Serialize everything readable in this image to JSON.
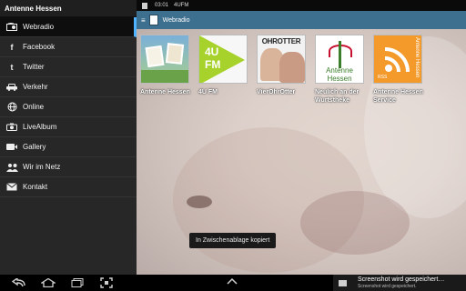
{
  "sidebar": {
    "title": "Antenne Hessen",
    "items": [
      {
        "label": "Webradio",
        "icon": "radio-icon",
        "active": true
      },
      {
        "label": "Facebook",
        "icon": "facebook-icon"
      },
      {
        "label": "Twitter",
        "icon": "twitter-icon"
      },
      {
        "label": "Verkehr",
        "icon": "car-icon"
      },
      {
        "label": "Online",
        "icon": "globe-icon"
      },
      {
        "label": "LiveAlbum",
        "icon": "camera-icon"
      },
      {
        "label": "Gallery",
        "icon": "video-camera-icon"
      },
      {
        "label": "Wir im Netz",
        "icon": "people-icon"
      },
      {
        "label": "Kontakt",
        "icon": "mail-icon"
      }
    ]
  },
  "statusbar": {
    "time": "03:01",
    "station": "4UFM"
  },
  "actionbar": {
    "title": "Webradio"
  },
  "tiles": [
    {
      "caption": "Antenne Hessen"
    },
    {
      "caption": "4U FM",
      "logo_line1": "4U",
      "logo_line2": "FM"
    },
    {
      "caption": "VierOhrOtter",
      "logo_text": "OHROTTER"
    },
    {
      "caption": "Neulich an der Wurtstheke",
      "logo_line1": "Antenne",
      "logo_line2": "Hessen"
    },
    {
      "caption": "Antenne Hessen Service",
      "logo_vertical": "Antenne Hessen",
      "logo_tag": "RSS"
    }
  ],
  "toast": "In Zwischenablage kopiert",
  "notification": {
    "title": "Screenshot wird gespeichert…",
    "subtitle": "Screenshot wird gespeichert."
  },
  "colors": {
    "actionbar": "#3d6f8e",
    "active_indicator": "#4fb3ff",
    "rss_orange": "#f39a2b",
    "fm_green": "#a6d22b"
  }
}
